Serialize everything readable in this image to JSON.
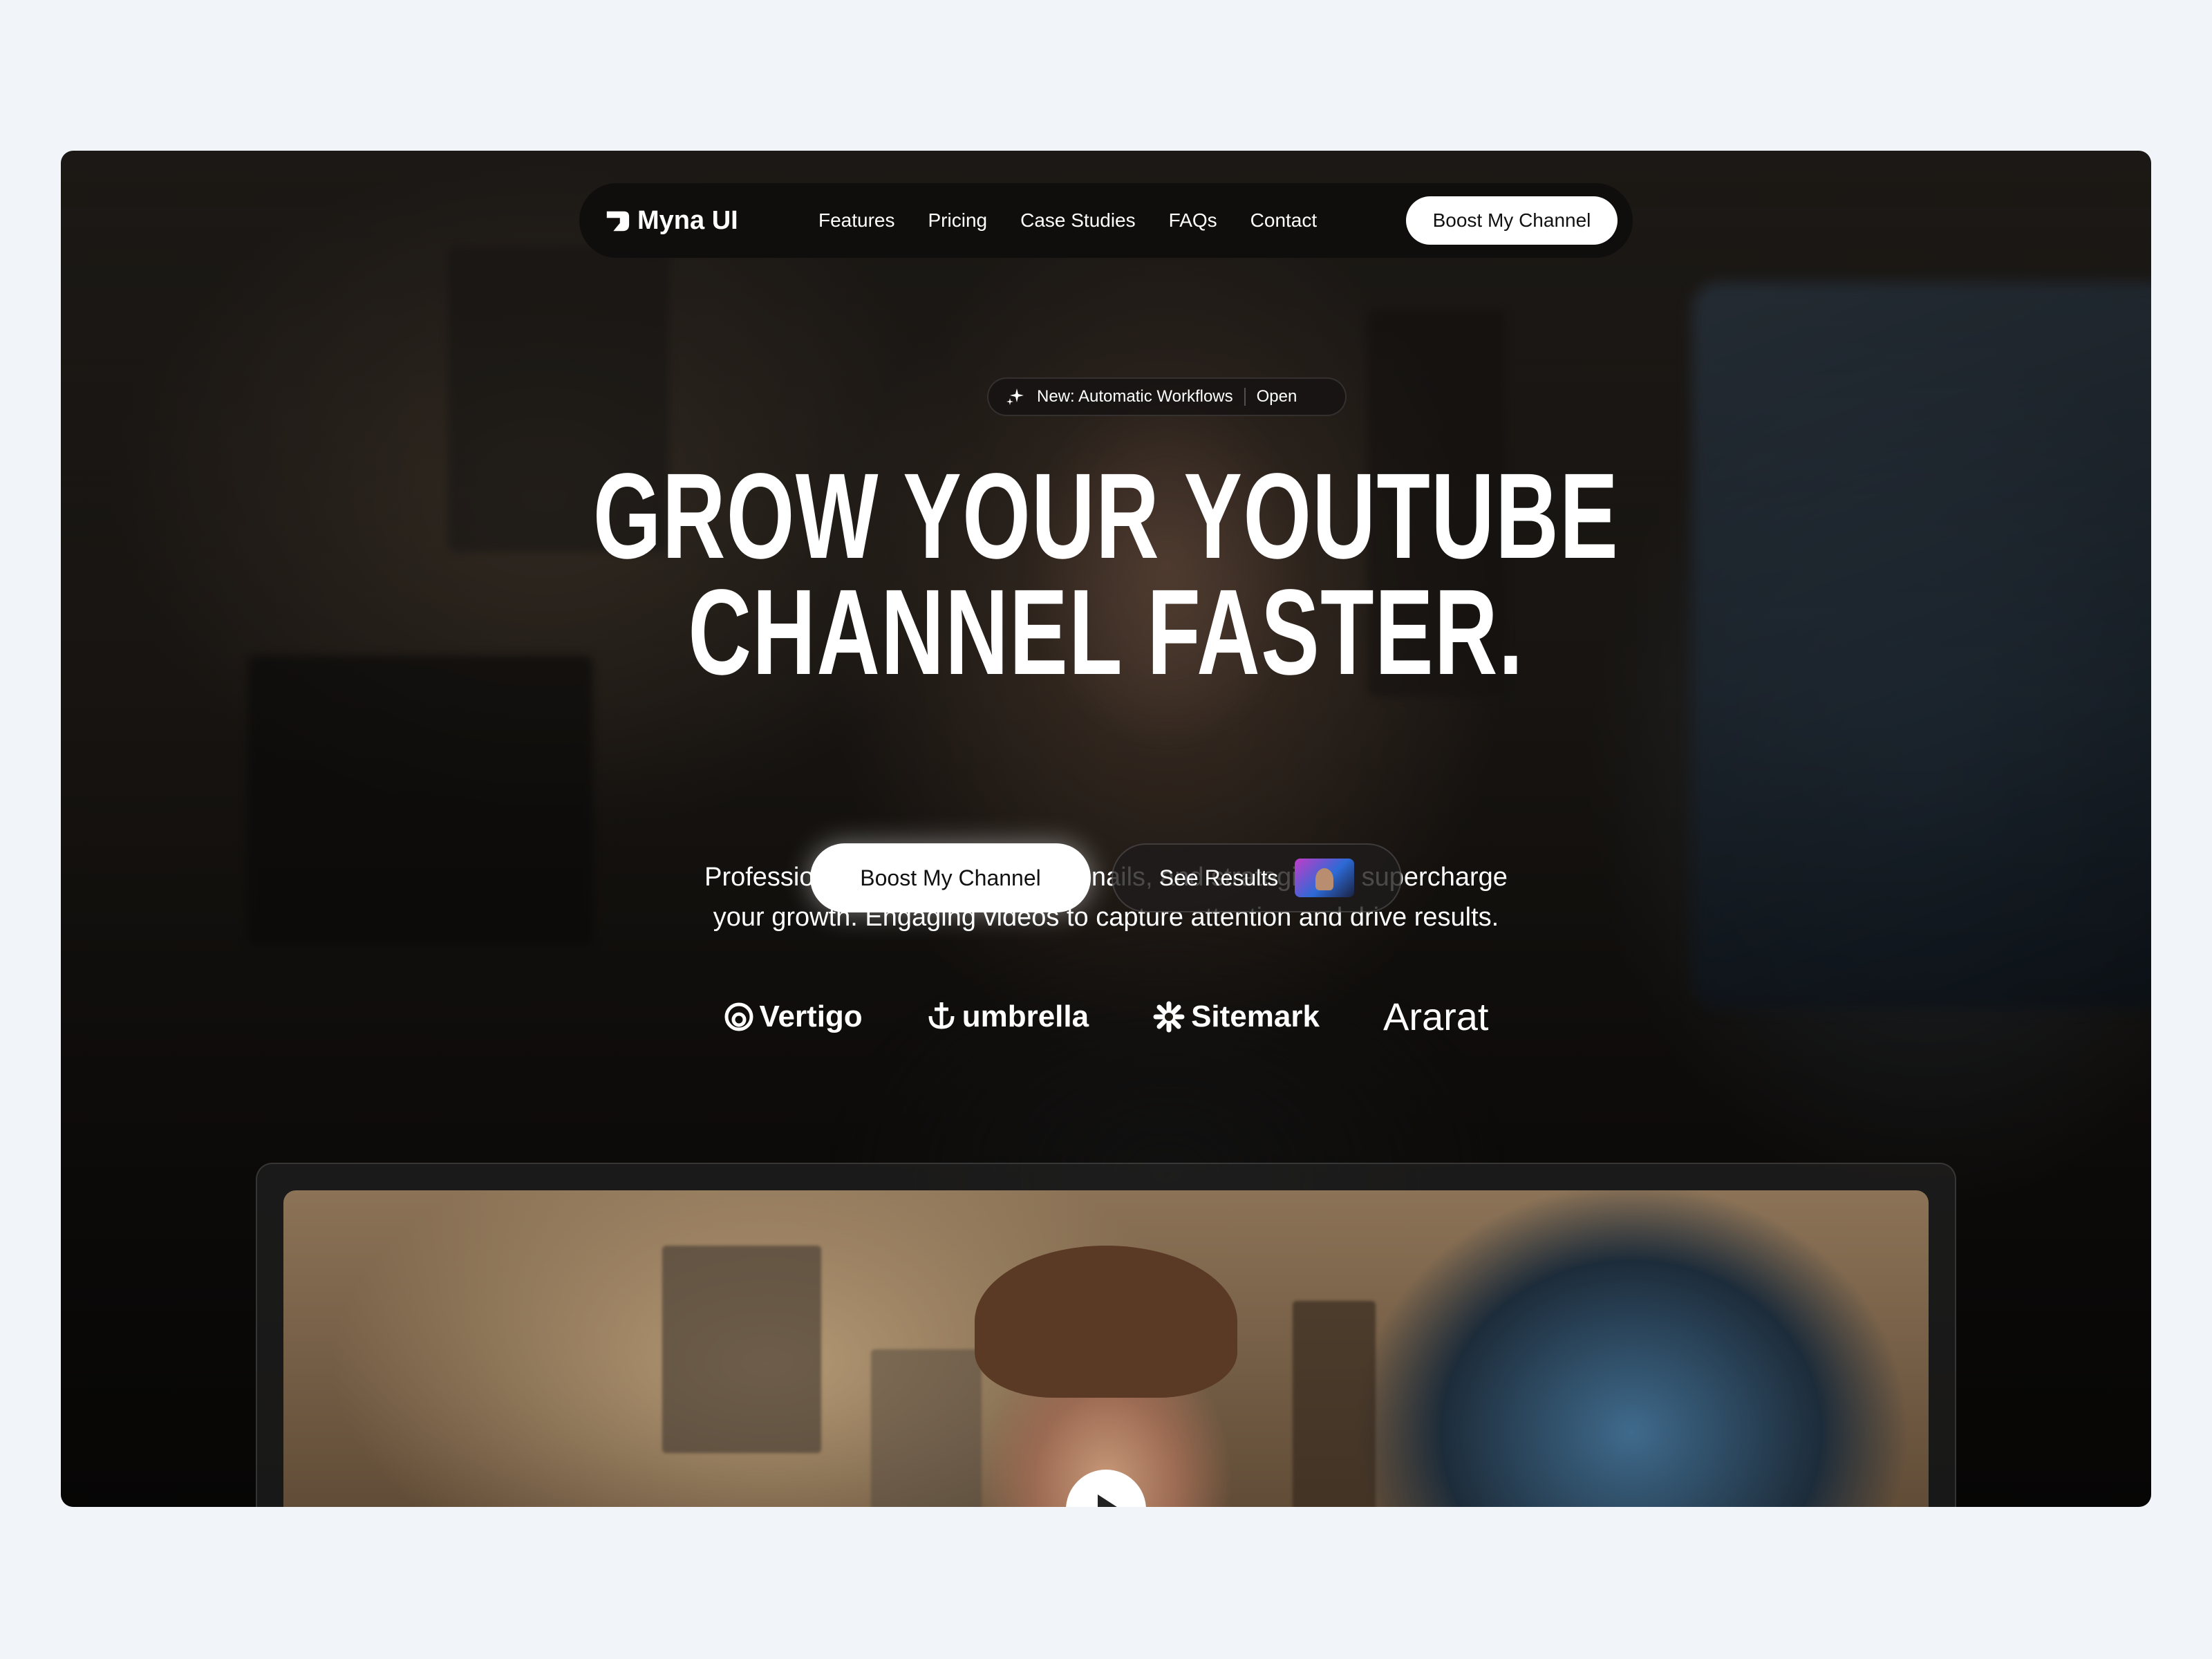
{
  "nav": {
    "logo_text": "Myna UI",
    "links": [
      "Features",
      "Pricing",
      "Case Studies",
      "FAQs",
      "Contact"
    ],
    "cta_label": "Boost My Channel"
  },
  "badge": {
    "text": "New: Automatic Workflows",
    "action": "Open",
    "icon": "sparkle-icon"
  },
  "hero": {
    "headline_line1": "GROW YOUR YOUTUBE",
    "headline_line2": "CHANNEL FASTER.",
    "subtext_line1": "Professional video editing, thumbnails, and strategies to supercharge",
    "subtext_line2": "your growth. Engaging videos to capture attention and drive results.",
    "primary_cta": "Boost My Channel",
    "secondary_cta": "See Results"
  },
  "brands": [
    "Vertigo",
    "umbrella",
    "Sitemark",
    "Ararat"
  ],
  "video": {
    "play_icon": "play-icon"
  },
  "colors": {
    "page_bg": "#f1f4f9",
    "nav_bg": "#0e0d0c",
    "button_light": "#ffffff"
  }
}
